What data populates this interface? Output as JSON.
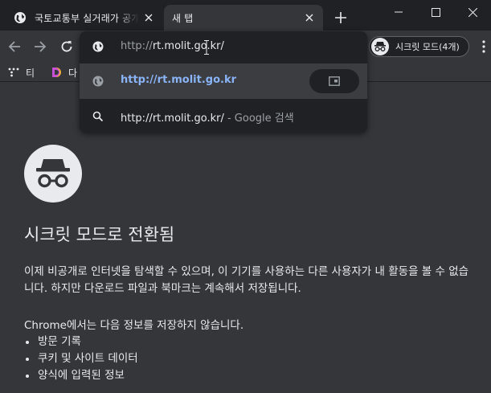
{
  "tabs": [
    {
      "title": "국토교통부 실거래가 공개시스템",
      "active": false
    },
    {
      "title": "새 탭",
      "active": true
    }
  ],
  "toolbar": {
    "incognito_label": "시크릿 모드(4개)"
  },
  "bookmarks": [
    {
      "label": "티"
    },
    {
      "label": "다"
    }
  ],
  "omnibox": {
    "scheme": "http://",
    "host_path": "rt.molit.go.kr/",
    "suggestions": [
      {
        "text": "http://rt.molit.go.kr",
        "suffix": "",
        "icon": "globe-icon",
        "action": "switch-to-tab-icon"
      },
      {
        "text": "http://rt.molit.go.kr/",
        "suffix": " - Google 검색",
        "icon": "search-icon"
      }
    ]
  },
  "content": {
    "heading": "시크릿 모드로 전환됨",
    "paragraph": "이제 비공개로 인터넷을 탐색할 수 있으며, 이 기기를 사용하는 다른 사용자가 내 활동을 볼 수 없습니다. 하지만 다운로드 파일과 북마크는 계속해서 저장됩니다.",
    "not_saved_heading": "Chrome에서는 다음 정보를 저장하지 않습니다.",
    "not_saved_items": [
      "방문 기록",
      "쿠키 및 사이트 데이터",
      "양식에 입력된 정보"
    ]
  },
  "colors": {
    "frame": "#202124",
    "toolbar": "#35363a",
    "text": "#e8eaed",
    "link": "#8ab4f8",
    "muted": "#9aa0a6"
  }
}
